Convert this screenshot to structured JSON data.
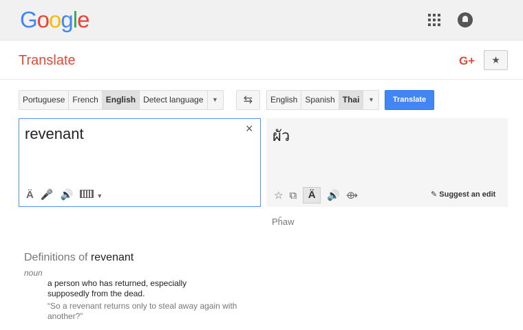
{
  "brand": {
    "letters": [
      "G",
      "o",
      "o",
      "g",
      "l",
      "e"
    ],
    "colors": [
      "#4285f4",
      "#ea4335",
      "#fbbc05",
      "#4285f4",
      "#34a853",
      "#ea4335"
    ]
  },
  "header": {
    "title": "Translate",
    "gplus": "G+"
  },
  "source_langs": [
    {
      "label": "Portuguese",
      "selected": false
    },
    {
      "label": "French",
      "selected": false
    },
    {
      "label": "English",
      "selected": true
    },
    {
      "label": "Detect language",
      "selected": false
    }
  ],
  "target_langs": [
    {
      "label": "English",
      "selected": false
    },
    {
      "label": "Spanish",
      "selected": false
    },
    {
      "label": "Thai",
      "selected": true
    }
  ],
  "translate_button": "Translate",
  "source": {
    "text": "revenant",
    "clear": "×"
  },
  "target": {
    "text": "ผัว",
    "transliteration": "Pĥaw",
    "suggest_edit": "Suggest an edit"
  },
  "definitions": {
    "label": "Definitions of",
    "word": "revenant",
    "pos": "noun",
    "gloss": "a person who has returned, especially supposedly from the dead.",
    "example": "“So a revenant returns only to steal away again with another?”"
  },
  "colors": {
    "accent": "#4285f4",
    "brand_red": "#dd4b39"
  }
}
